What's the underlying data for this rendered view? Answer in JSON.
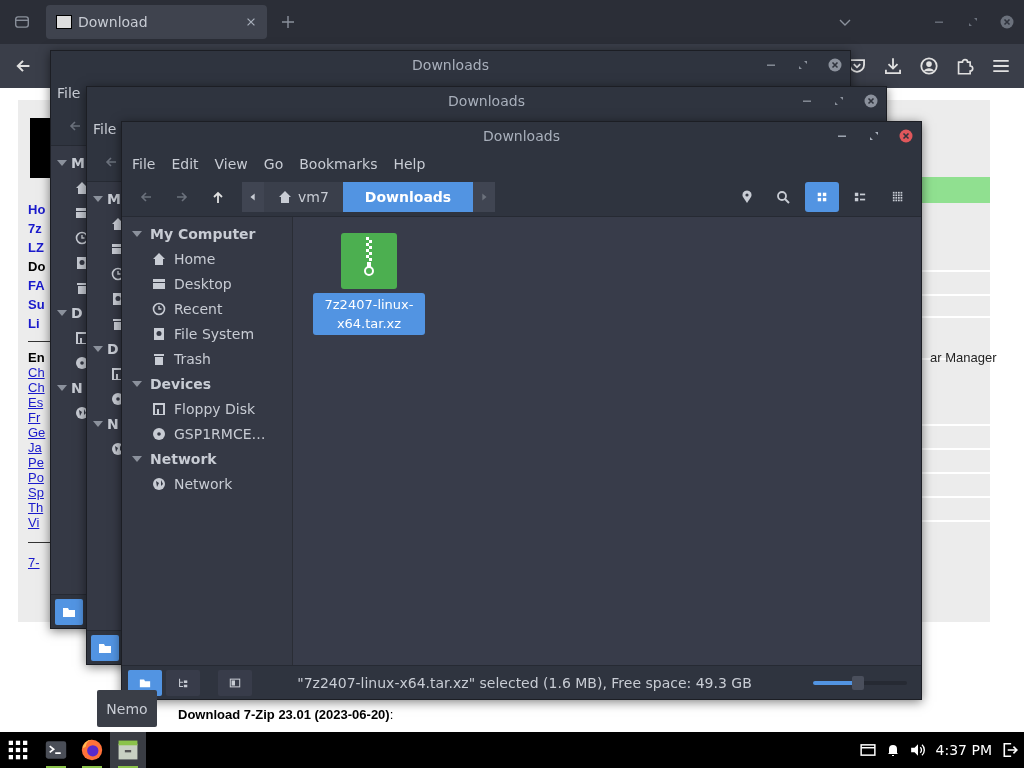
{
  "browser": {
    "tab": {
      "title": "Download"
    },
    "page": {
      "links": [
        {
          "text": "Ho",
          "kind": "nav"
        },
        {
          "text": "7z",
          "kind": "nav"
        },
        {
          "text": "LZ",
          "kind": "nav"
        },
        {
          "text": "Do",
          "kind": "current"
        },
        {
          "text": "FA",
          "kind": "nav"
        },
        {
          "text": "Su",
          "kind": "nav"
        },
        {
          "text": "Li",
          "kind": "nav"
        }
      ],
      "languages_heading": "En",
      "languages": [
        "Ch",
        "Ch",
        "Es",
        "Fr",
        "Ge",
        "Ja",
        "Pe",
        "Po",
        "Sp",
        "Th",
        "Vi"
      ],
      "footer_link": "7-",
      "table_text": "ar Manager",
      "download_text": "Download 7-Zip 23.01 (2023-06-20)",
      "download_suffix": ":"
    }
  },
  "back_windows": [
    {
      "title": "Downloads",
      "menu": "File",
      "sections": [
        {
          "title": "M",
          "items": [
            {
              "kind": "home"
            },
            {
              "kind": "desktop"
            },
            {
              "kind": "recent"
            },
            {
              "kind": "drive"
            },
            {
              "kind": "trash"
            }
          ]
        },
        {
          "title": "D",
          "items": [
            {
              "kind": "floppy"
            },
            {
              "kind": "disc"
            }
          ]
        },
        {
          "title": "N",
          "items": [
            {
              "kind": "network"
            }
          ]
        }
      ]
    },
    {
      "title": "Downloads",
      "menu": "File",
      "sections": [
        {
          "title": "M",
          "items": [
            {
              "kind": "home"
            },
            {
              "kind": "desktop"
            },
            {
              "kind": "recent"
            },
            {
              "kind": "drive"
            },
            {
              "kind": "trash"
            }
          ]
        },
        {
          "title": "D",
          "items": [
            {
              "kind": "floppy"
            },
            {
              "kind": "disc"
            }
          ]
        },
        {
          "title": "N",
          "items": [
            {
              "kind": "network"
            }
          ]
        }
      ]
    }
  ],
  "window": {
    "title": "Downloads",
    "menu": [
      "File",
      "Edit",
      "View",
      "Go",
      "Bookmarks",
      "Help"
    ],
    "path": [
      {
        "label": "vm7",
        "kind": "home",
        "selected": false
      },
      {
        "label": "Downloads",
        "kind": "folder",
        "selected": true
      }
    ],
    "views": [
      {
        "kind": "icons",
        "selected": true
      },
      {
        "kind": "list",
        "selected": false
      },
      {
        "kind": "compact",
        "selected": false
      }
    ],
    "sidebar": [
      {
        "title": "My Computer",
        "expanded": true,
        "children": [
          {
            "label": "Home",
            "kind": "home"
          },
          {
            "label": "Desktop",
            "kind": "desktop"
          },
          {
            "label": "Recent",
            "kind": "recent"
          },
          {
            "label": "File System",
            "kind": "drive"
          },
          {
            "label": "Trash",
            "kind": "trash"
          }
        ]
      },
      {
        "title": "Devices",
        "expanded": true,
        "children": [
          {
            "label": "Floppy Disk",
            "kind": "floppy"
          },
          {
            "label": "GSP1RMCE…",
            "kind": "disc"
          }
        ]
      },
      {
        "title": "Network",
        "expanded": true,
        "children": [
          {
            "label": "Network",
            "kind": "network"
          }
        ]
      }
    ],
    "files": [
      {
        "name": "7z2407-linux-x64.tar.xz",
        "selected": true
      }
    ],
    "status": "\"7z2407-linux-x64.tar.xz\" selected (1.6 MB), Free space: 49.3 GB",
    "zoom": {
      "level": 0.48
    },
    "bottom_buttons": [
      {
        "kind": "places",
        "selected": true
      },
      {
        "kind": "tree",
        "selected": false
      },
      {
        "kind": "sidebar",
        "selected": false
      }
    ]
  },
  "tooltip": "Nemo",
  "taskbar": {
    "apps": [
      {
        "kind": "terminal",
        "running": true,
        "active": false
      },
      {
        "kind": "firefox",
        "running": true,
        "active": false
      },
      {
        "kind": "files",
        "running": true,
        "active": true
      }
    ],
    "clock": "4:37 PM"
  }
}
